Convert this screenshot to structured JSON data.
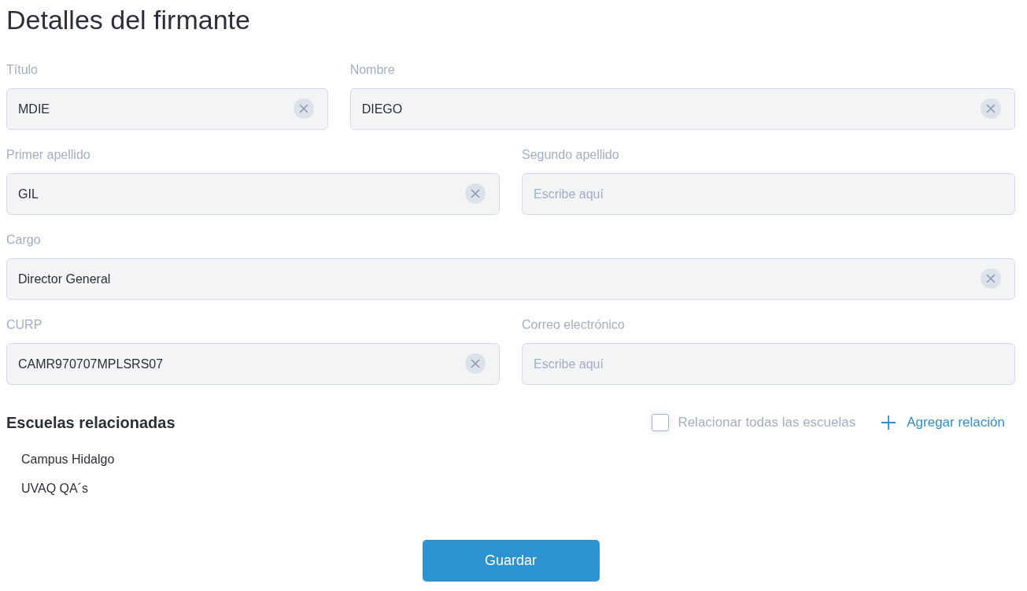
{
  "title": "Detalles del firmante",
  "form": {
    "rows": [
      {
        "fields": [
          {
            "label": "Título",
            "value": "MDIE",
            "clearable": true
          },
          {
            "label": "Nombre",
            "value": "DIEGO",
            "clearable": true
          }
        ]
      },
      {
        "fields": [
          {
            "label": "Primer apellido",
            "value": "GIL",
            "clearable": true
          },
          {
            "label": "Segundo apellido",
            "placeholder": "Escribe aquí",
            "clearable": false
          }
        ]
      },
      {
        "fields": [
          {
            "label": "Cargo",
            "value": "Director General",
            "clearable": true
          }
        ]
      },
      {
        "fields": [
          {
            "label": "CURP",
            "value": "CAMR970707MPLSRS07",
            "clearable": true
          },
          {
            "label": "Correo electrónico",
            "placeholder": "Escribe aquí",
            "clearable": false
          }
        ]
      }
    ]
  },
  "schools": {
    "heading": "Escuelas relacionadas",
    "select_all": {
      "label": "Relacionar todas las escuelas",
      "checked": false
    },
    "add_link": "Agregar relación",
    "items": [
      "Campus Hidalgo",
      "UVAQ QA´s"
    ]
  },
  "save_button": "Guardar"
}
